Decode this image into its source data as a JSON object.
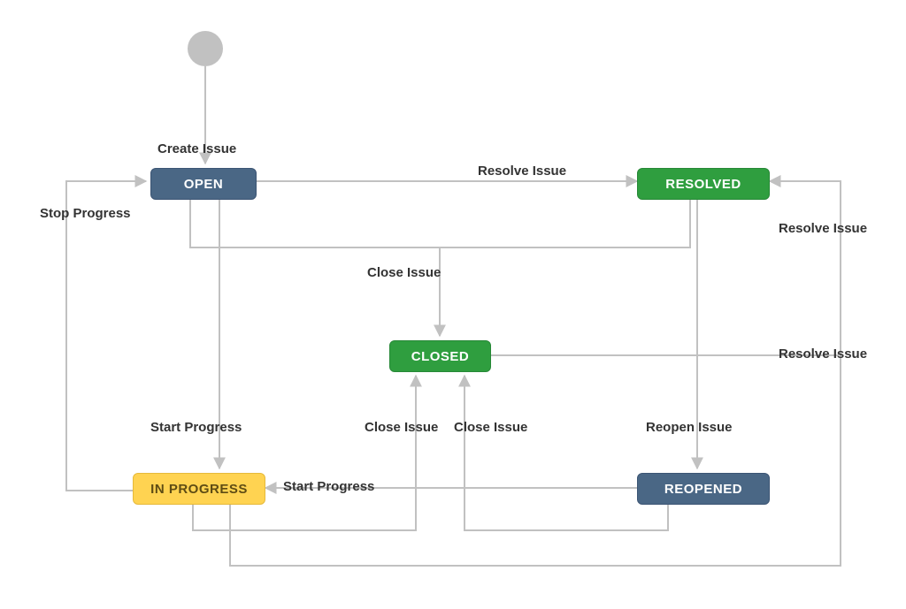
{
  "nodes": {
    "open": {
      "label": "OPEN"
    },
    "resolved": {
      "label": "RESOLVED"
    },
    "closed": {
      "label": "CLOSED"
    },
    "inprogress": {
      "label": "IN PROGRESS"
    },
    "reopened": {
      "label": "REOPENED"
    }
  },
  "edges": {
    "create_issue": {
      "label": "Create Issue"
    },
    "resolve_open": {
      "label": "Resolve Issue"
    },
    "stop_progress": {
      "label": "Stop Progress"
    },
    "close_open_resolved": {
      "label": "Close Issue"
    },
    "start_progress_open": {
      "label": "Start Progress"
    },
    "close_inprogress": {
      "label": "Close Issue"
    },
    "close_reopened": {
      "label": "Close Issue"
    },
    "reopen_issue": {
      "label": "Reopen Issue"
    },
    "start_progress_reopened": {
      "label": "Start Progress"
    },
    "resolve_inprogress": {
      "label": "Resolve Issue"
    },
    "resolve_reopened": {
      "label": "Resolve Issue"
    }
  },
  "colors": {
    "blue": "#4a6785",
    "green": "#2f9e3f",
    "yellow": "#ffd351",
    "arrow": "#c1c1c1",
    "text": "#333333"
  }
}
